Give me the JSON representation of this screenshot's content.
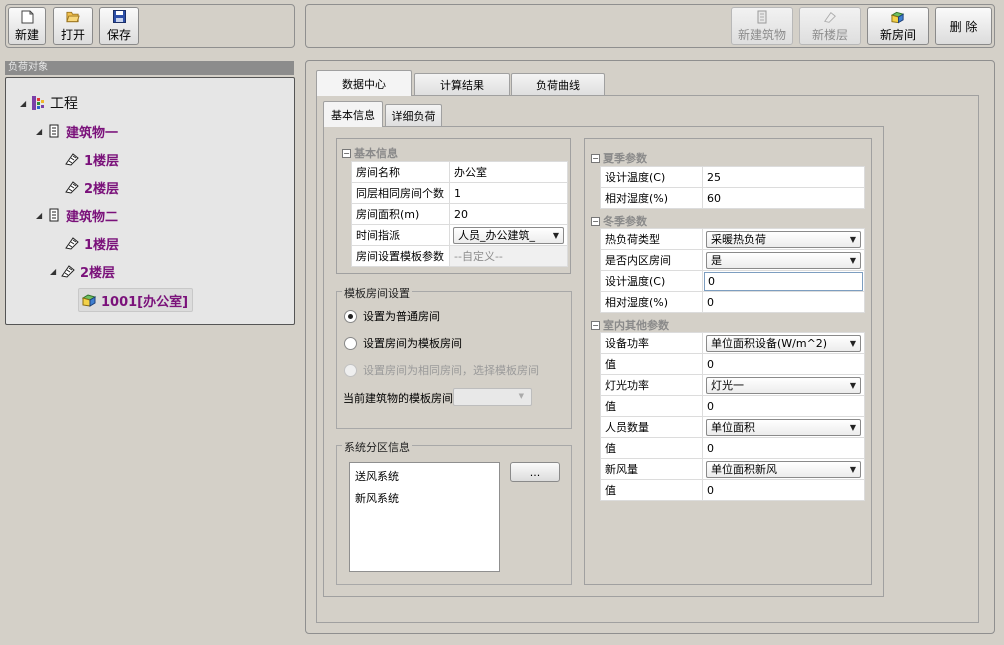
{
  "toolbar_left": {
    "new_label": "新建",
    "open_label": "打开",
    "save_label": "保存"
  },
  "toolbar_right": {
    "new_building_label": "新建筑物",
    "new_floor_label": "新楼层",
    "new_room_label": "新房间",
    "delete_label": "删 除"
  },
  "tree": {
    "header": "负荷对象",
    "root": "工程",
    "building1": "建筑物一",
    "b1_floor1": "1楼层",
    "b1_floor2": "2楼层",
    "building2": "建筑物二",
    "b2_floor1": "1楼层",
    "b2_floor2": "2楼层",
    "room": "1001[办公室]"
  },
  "tabs": {
    "data_center": "数据中心",
    "calc_result": "计算结果",
    "load_curve": "负荷曲线",
    "basic_info": "基本信息",
    "detail_load": "详细负荷"
  },
  "basic": {
    "section": "基本信息",
    "room_name_label": "房间名称",
    "room_name_value": "办公室",
    "same_count_label": "同层相同房间个数",
    "same_count_value": "1",
    "area_label": "房间面积(m)",
    "area_value": "20",
    "time_label": "时间指派",
    "time_value": "人员_办公建筑_",
    "template_param_label": "房间设置模板参数",
    "template_param_value": "--自定义--"
  },
  "template_room": {
    "title": "模板房间设置",
    "opt1": "设置为普通房间",
    "opt2": "设置房间为模板房间",
    "opt3": "设置房间为相同房间，选择模板房间",
    "current_label": "当前建筑物的模板房间"
  },
  "zone": {
    "title": "系统分区信息",
    "items": [
      "送风系统",
      "新风系统"
    ],
    "btn": "..."
  },
  "summer": {
    "section": "夏季参数",
    "temp_label": "设计温度(C)",
    "temp_value": "25",
    "hum_label": "相对湿度(%)",
    "hum_value": "60"
  },
  "winter": {
    "section": "冬季参数",
    "heat_type_label": "热负荷类型",
    "heat_type_value": "采暖热负荷",
    "inner_label": "是否内区房间",
    "inner_value": "是",
    "temp_label": "设计温度(C)",
    "temp_value": "0",
    "hum_label": "相对湿度(%)",
    "hum_value": "0"
  },
  "indoor": {
    "section": "室内其他参数",
    "equip_label": "设备功率",
    "equip_value": "单位面积设备(W/m^2)",
    "equip_val_label": "值",
    "equip_val": "0",
    "light_label": "灯光功率",
    "light_value": "灯光一",
    "light_val_label": "值",
    "light_val": "0",
    "people_label": "人员数量",
    "people_value": "单位面积",
    "people_val_label": "值",
    "people_val": "0",
    "fresh_label": "新风量",
    "fresh_value": "单位面积新风",
    "fresh_val_label": "值",
    "fresh_val": "0"
  }
}
